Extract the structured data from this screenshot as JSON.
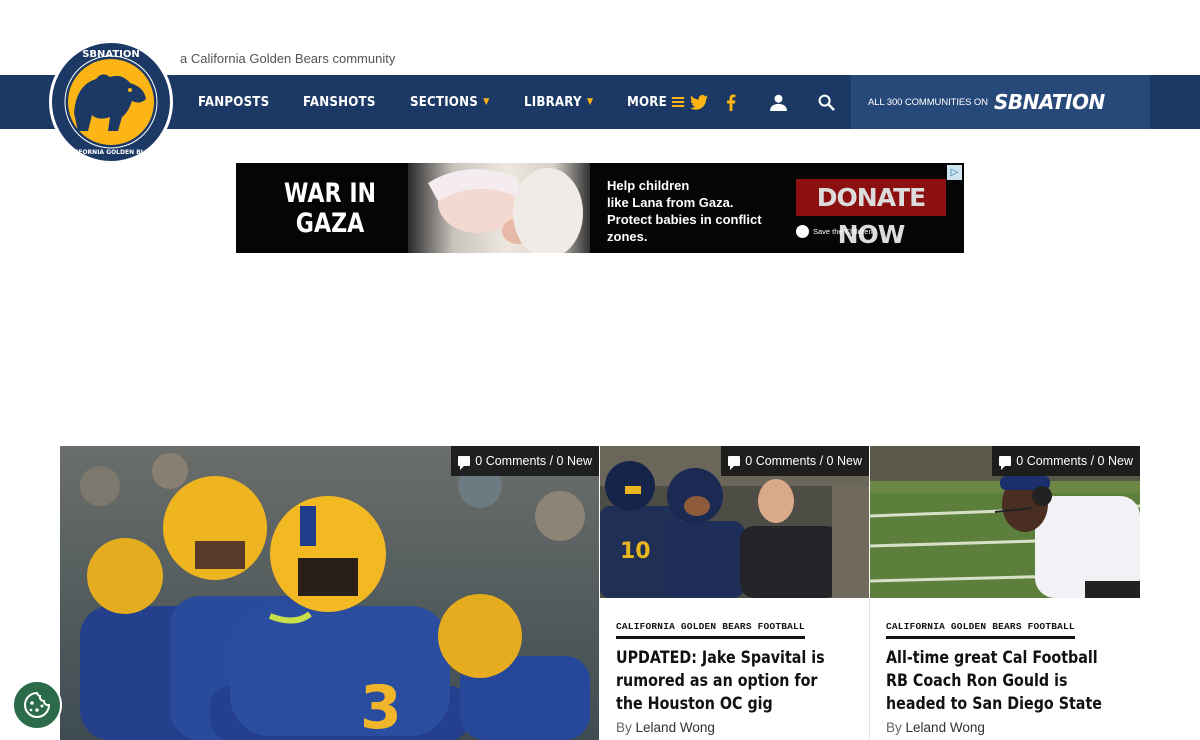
{
  "site": {
    "tagline": "a California Golden Bears community",
    "logo_alt": "California Golden Blogs"
  },
  "nav": {
    "items": [
      {
        "label": "FANPOSTS",
        "has_caret": false
      },
      {
        "label": "FANSHOTS",
        "has_caret": false
      },
      {
        "label": "SECTIONS",
        "has_caret": true
      },
      {
        "label": "LIBRARY",
        "has_caret": true
      },
      {
        "label": "MORE",
        "has_menu": true
      }
    ],
    "icons": [
      "twitter-icon",
      "facebook-icon",
      "user-icon",
      "search-icon"
    ],
    "sbnation": {
      "small_label": "All 300 Communities on",
      "brand": "SBNATION"
    }
  },
  "ad": {
    "headline": "WAR IN\nGAZA",
    "body": "Help children\nlike Lana from Gaza.\nProtect babies in conflict\nzones.",
    "cta": "DONATE NOW",
    "sponsor": "Save the Children"
  },
  "stories": [
    {
      "comments": "0 Comments / 0 New",
      "category": "",
      "headline": "",
      "author": ""
    },
    {
      "comments": "0 Comments / 0 New",
      "category": "CALIFORNIA GOLDEN BEARS FOOTBALL",
      "headline": "UPDATED: Jake Spavital is rumored as an option for the Houston OC gig",
      "byline_prefix": "By",
      "author": "Leland Wong"
    },
    {
      "comments": "0 Comments / 0 New",
      "category": "CALIFORNIA GOLDEN BEARS FOOTBALL",
      "headline": "All-time great Cal Football RB Coach Ron Gould is headed to San Diego State",
      "byline_prefix": "By",
      "author": "Leland Wong"
    }
  ],
  "colors": {
    "navy": "#1c3965",
    "gold": "#fdb515",
    "sbn_blue": "#27497a"
  }
}
